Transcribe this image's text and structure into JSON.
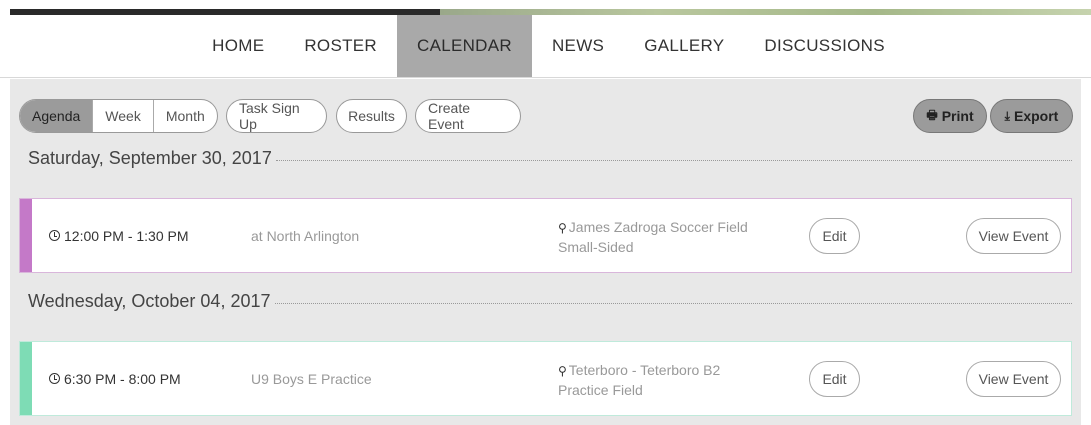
{
  "nav": {
    "items": [
      {
        "label": "HOME"
      },
      {
        "label": "ROSTER"
      },
      {
        "label": "CALENDAR",
        "active": true
      },
      {
        "label": "NEWS"
      },
      {
        "label": "GALLERY"
      },
      {
        "label": "DISCUSSIONS"
      }
    ]
  },
  "toolbar": {
    "view_tabs": [
      {
        "label": "Agenda",
        "active": true
      },
      {
        "label": "Week"
      },
      {
        "label": "Month"
      }
    ],
    "task_signup_label": "Task Sign Up",
    "results_label": "Results",
    "create_event_label": "Create Event",
    "print_label": "Print",
    "export_label": "Export",
    "print_icon": "printer-icon",
    "export_icon": "download-icon"
  },
  "days": [
    {
      "date": "Saturday, September 30, 2017",
      "events": [
        {
          "time": "12:00 PM - 1:30 PM",
          "title": "at North Arlington",
          "location_line1": "James Zadroga Soccer Field",
          "location_line2": "Small-Sided",
          "edit_label": "Edit",
          "view_label": "View Event",
          "color": "#c479c8"
        }
      ]
    },
    {
      "date": "Wednesday, October 04, 2017",
      "events": [
        {
          "time": "6:30 PM - 8:00 PM",
          "title": "U9 Boys E Practice",
          "location_line1": "Teterboro - Teterboro B2",
          "location_line2": "Practice Field",
          "edit_label": "Edit",
          "view_label": "View Event",
          "color": "#7edcb5"
        }
      ]
    }
  ]
}
